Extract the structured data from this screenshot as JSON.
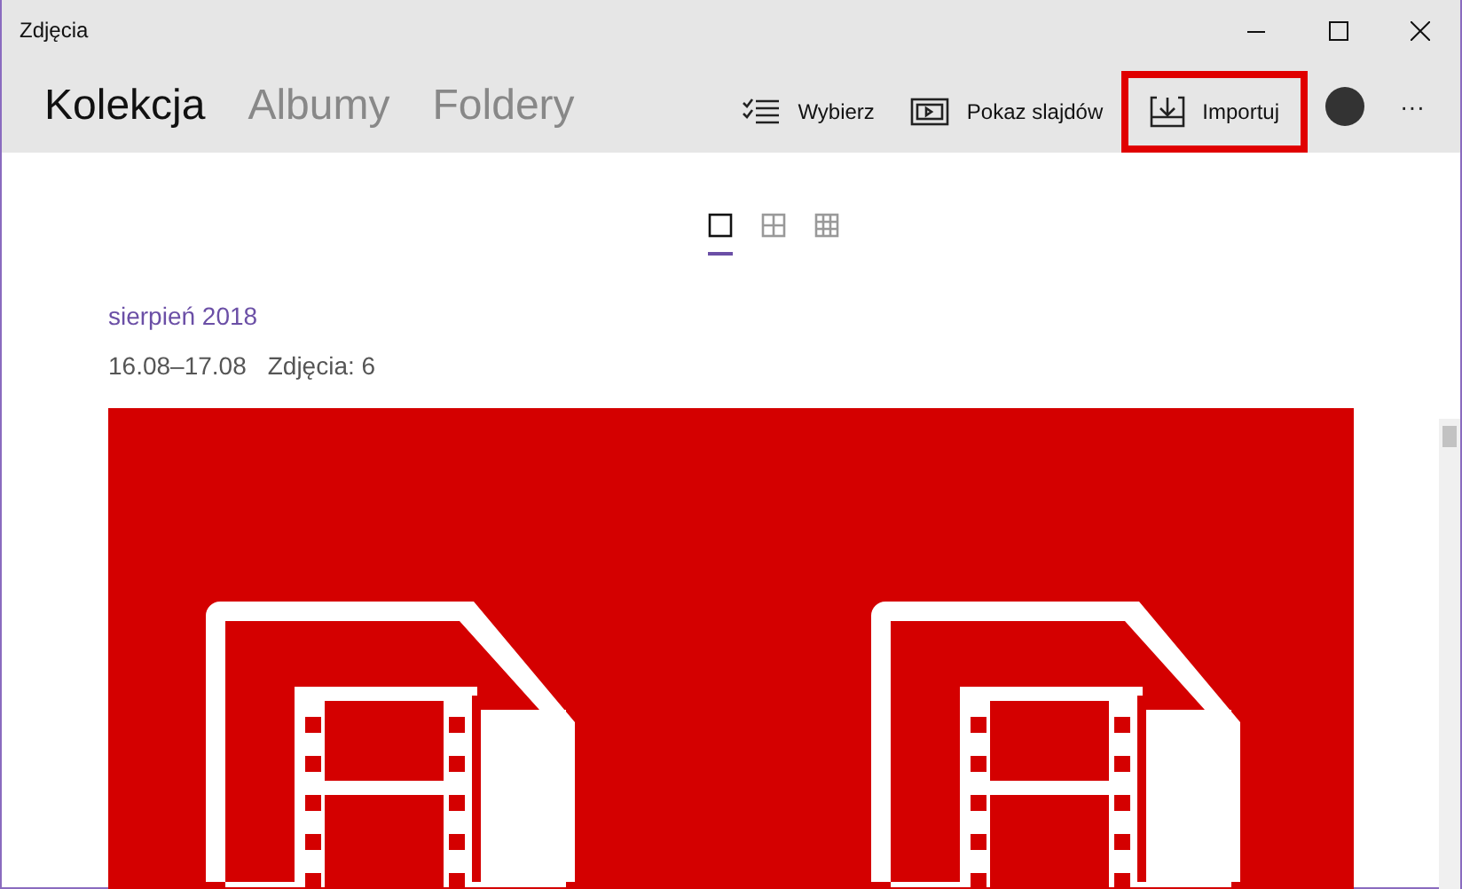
{
  "window": {
    "title": "Zdjęcia"
  },
  "tabs": [
    {
      "label": "Kolekcja",
      "selected": true
    },
    {
      "label": "Albumy",
      "selected": false
    },
    {
      "label": "Foldery",
      "selected": false
    }
  ],
  "commands": [
    {
      "kind": "select",
      "label": "Wybierz",
      "highlighted": false
    },
    {
      "kind": "slideshow",
      "label": "Pokaz slajdów",
      "highlighted": false
    },
    {
      "kind": "import",
      "label": "Importuj",
      "highlighted": true
    }
  ],
  "more": "···",
  "view_sizes": [
    {
      "kind": "large",
      "selected": true
    },
    {
      "kind": "medium",
      "selected": false
    },
    {
      "kind": "small",
      "selected": false
    }
  ],
  "groups": [
    {
      "title": "sierpień 2018",
      "dates": "16.08–17.08",
      "count": "Zdjęcia: 6"
    }
  ]
}
